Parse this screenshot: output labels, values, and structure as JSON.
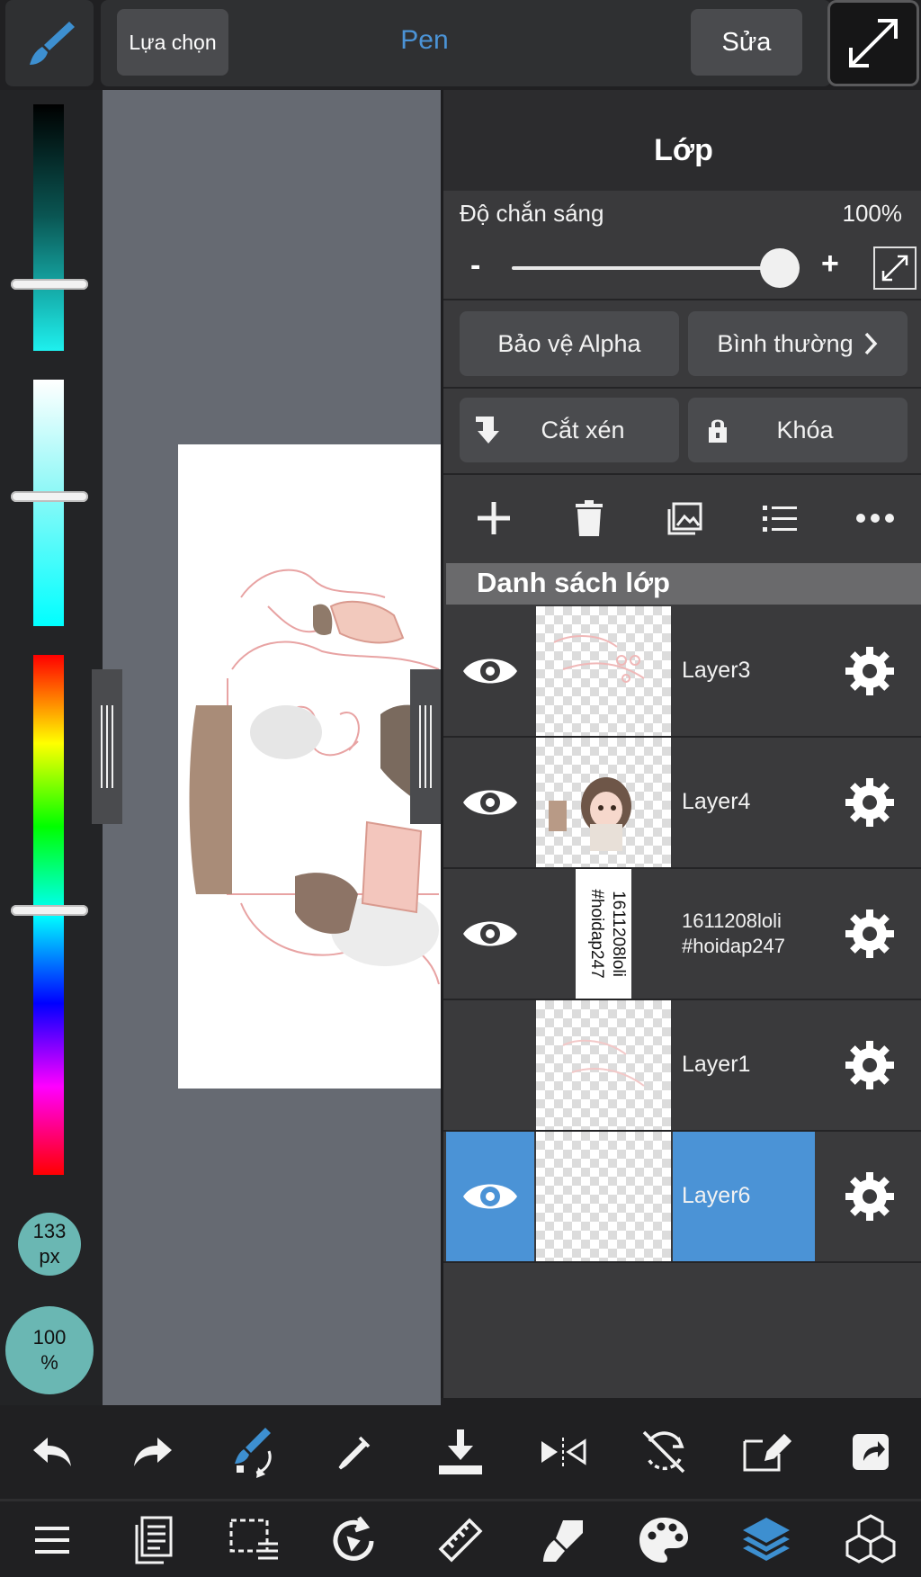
{
  "topbar": {
    "select_label": "Lựa chọn",
    "tool_name": "Pen",
    "edit_label": "Sửa"
  },
  "left_panel": {
    "size_value": "133",
    "size_unit": "px",
    "opacity_value": "100",
    "opacity_unit": "%"
  },
  "layer_panel": {
    "title": "Lớp",
    "opacity_label": "Độ chắn sáng",
    "opacity_value": "100%",
    "opacity_fraction": 1.0,
    "minus": "-",
    "plus": "+",
    "alpha_protect_label": "Bảo vệ Alpha",
    "blend_mode_label": "Bình thường",
    "clipping_label": "Cắt xén",
    "lock_label": "Khóa",
    "list_header": "Danh sách lớp",
    "layers": [
      {
        "name": "Layer3",
        "visible": true,
        "selected": false
      },
      {
        "name": "Layer4",
        "visible": true,
        "selected": false
      },
      {
        "name": "1611208loli\n#hoidap247",
        "visible": true,
        "selected": false,
        "thumb_text": "1611208loli\n#hoidap247"
      },
      {
        "name": "Layer1",
        "visible": false,
        "selected": false
      },
      {
        "name": "Layer6",
        "visible": true,
        "selected": true
      }
    ]
  },
  "colors": {
    "accent": "#4b93d6",
    "teal": "#6ab7b3",
    "panel_bg": "#3a3a3c",
    "button_bg": "#4a4b4e"
  }
}
